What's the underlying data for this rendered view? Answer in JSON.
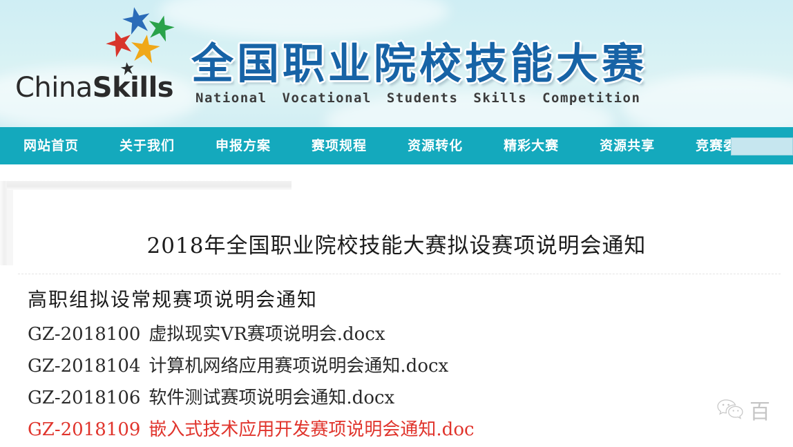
{
  "banner": {
    "logo_wordmark_part1": "China",
    "logo_wordmark_part2": "Skills",
    "title": "全国职业院校技能大赛",
    "subtitle_words": [
      "National",
      "Vocational",
      "Students",
      "Skills",
      "Competition"
    ],
    "colors": {
      "title_blue": "#1763a6",
      "background": "#d6f1f4"
    },
    "stars": [
      {
        "name": "star-blue",
        "color": "#2b6cb8"
      },
      {
        "name": "star-green",
        "color": "#2aa24a"
      },
      {
        "name": "star-red",
        "color": "#d8352c"
      },
      {
        "name": "star-orange",
        "color": "#f0a818"
      },
      {
        "name": "star-black",
        "color": "#2c2c2c"
      }
    ]
  },
  "nav": {
    "accent_color": "#14a9bd",
    "items": [
      {
        "label": "网站首页"
      },
      {
        "label": "关于我们"
      },
      {
        "label": "申报方案"
      },
      {
        "label": "赛项规程"
      },
      {
        "label": "资源转化"
      },
      {
        "label": "精彩大赛"
      },
      {
        "label": "资源共享"
      },
      {
        "label": "竞赛委"
      }
    ],
    "search": {
      "value": "",
      "placeholder": ""
    }
  },
  "content": {
    "page_title": "2018年全国职业院校技能大赛拟设赛项说明会通知",
    "list_heading": "高职组拟设常规赛项说明会通知",
    "items": [
      {
        "code": "GZ-2018100",
        "name": "虚拟现实VR赛项说明会.docx",
        "highlight": false
      },
      {
        "code": "GZ-2018104",
        "name": "计算机网络应用赛项说明会通知.docx",
        "highlight": false
      },
      {
        "code": "GZ-2018106",
        "name": "软件测试赛项说明会通知.docx",
        "highlight": false
      },
      {
        "code": "GZ-2018109",
        "name": "嵌入式技术应用开发赛项说明会通知.doc",
        "highlight": true
      }
    ],
    "highlight_color": "#e0342c"
  },
  "watermark": {
    "icon": "wechat-icon",
    "text": "百"
  }
}
